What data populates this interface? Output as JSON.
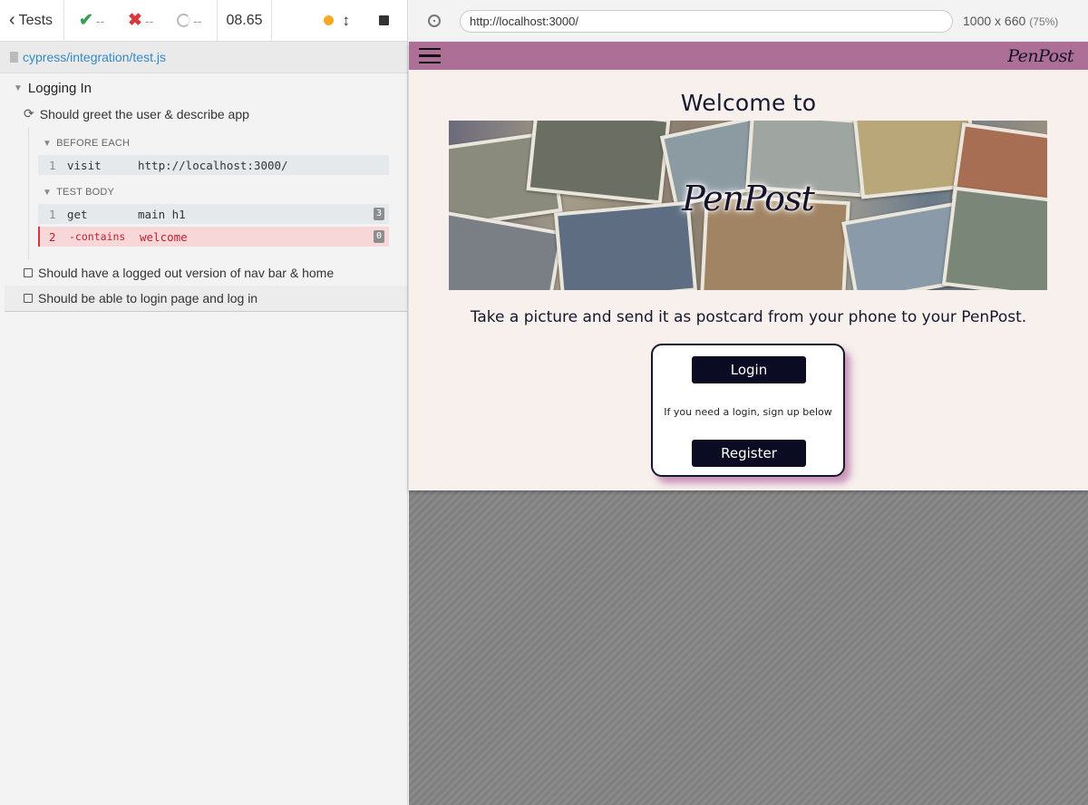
{
  "reporter": {
    "tests_label": "Tests",
    "passed": "--",
    "failed": "--",
    "pending": "--",
    "duration": "08.65",
    "spec_file": "cypress/integration/test.js",
    "suite_title": "Logging In",
    "tests": [
      {
        "title": "Should greet the user & describe app",
        "state": "running"
      },
      {
        "title": "Should have a logged out version of nav bar & home",
        "state": "idle"
      },
      {
        "title": "Should be able to login page and log in",
        "state": "idle"
      }
    ],
    "hooks": [
      {
        "title": "BEFORE EACH",
        "commands": [
          {
            "num": "1",
            "name": "visit",
            "message": "http://localhost:3000/",
            "count": ""
          }
        ]
      },
      {
        "title": "TEST BODY",
        "commands": [
          {
            "num": "1",
            "name": "get",
            "message": "main h1",
            "count": "3"
          },
          {
            "num": "2",
            "name": "-contains",
            "message": "welcome",
            "count": "0"
          }
        ]
      }
    ]
  },
  "aut": {
    "url": "http://localhost:3000/",
    "viewport": "1000 x 660",
    "scale": "(75%)",
    "app": {
      "brand": "PenPost",
      "heading": "Welcome to",
      "hero_brand": "PenPost",
      "tagline": "Take a picture and send it as postcard from your phone to your PenPost.",
      "login_label": "Login",
      "signup_hint": "If you need a login, sign up below",
      "register_label": "Register"
    }
  },
  "colors": {
    "nav": "#ad6f96",
    "button": "#0c0b24",
    "fail": "#d9363e",
    "pass": "#3a9c57"
  }
}
